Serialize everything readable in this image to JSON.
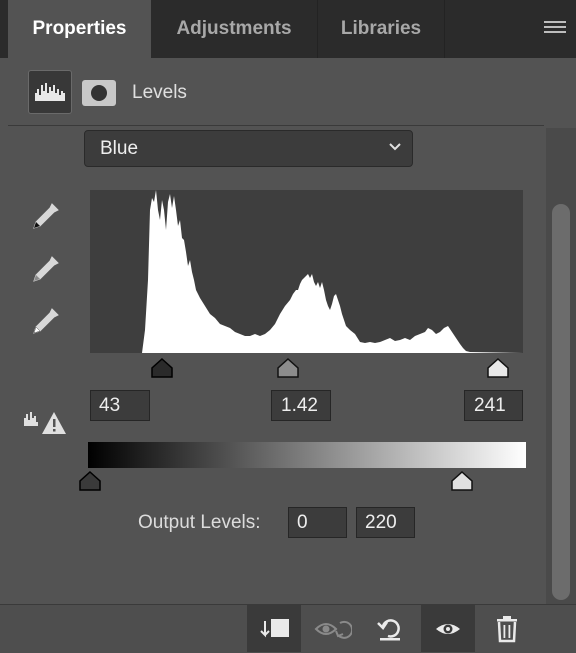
{
  "tabs": [
    {
      "label": "Properties",
      "active": true
    },
    {
      "label": "Adjustments",
      "active": false
    },
    {
      "label": "Libraries",
      "active": false
    }
  ],
  "header": {
    "title": "Levels",
    "icon": "levels-histogram-icon",
    "mask_icon": "mask-icon"
  },
  "channel": {
    "selected": "Blue"
  },
  "input_levels": {
    "black": "43",
    "gamma": "1.42",
    "white": "241"
  },
  "output_levels": {
    "label": "Output Levels:",
    "black": "0",
    "white": "220"
  },
  "icons": {
    "eyedroppers": [
      "black-point-eyedropper-icon",
      "gray-point-eyedropper-icon",
      "white-point-eyedropper-icon"
    ],
    "clipping_warning": "clipping-warning-icon",
    "bottom": [
      "clip-to-layer-icon",
      "view-previous-state-icon",
      "reset-icon",
      "visibility-icon",
      "delete-icon"
    ]
  },
  "colors": {
    "panel": "#535353",
    "tabbar": "#2b2b2b",
    "histogram_fill": "#ffffff"
  }
}
